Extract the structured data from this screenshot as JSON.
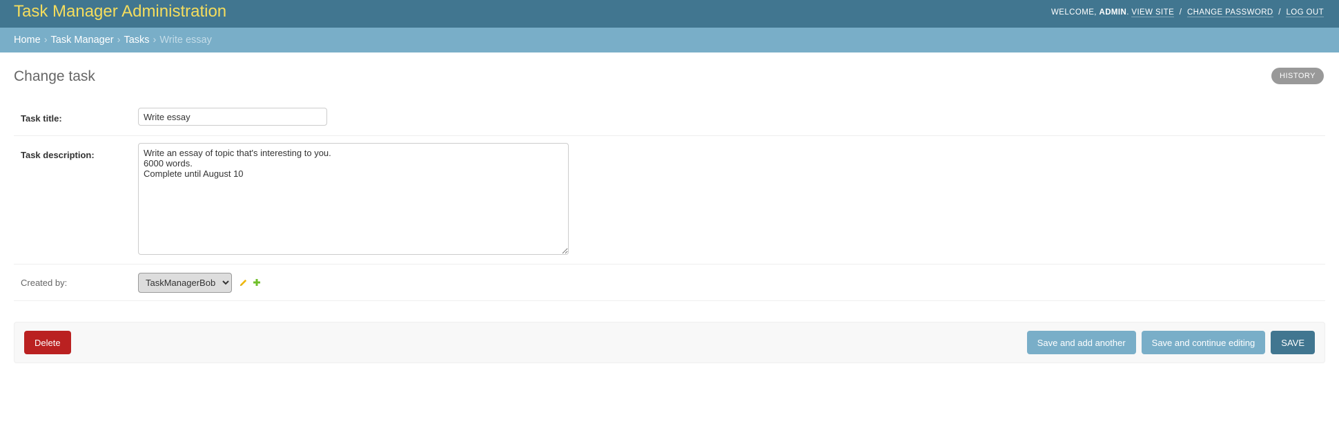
{
  "header": {
    "site_title": "Task Manager Administration",
    "welcome": "WELCOME,",
    "username": "ADMIN",
    "view_site": "VIEW SITE",
    "change_password": "CHANGE PASSWORD",
    "log_out": "LOG OUT",
    "separator": "/"
  },
  "breadcrumbs": {
    "items": [
      "Home",
      "Task Manager",
      "Tasks"
    ],
    "current": "Write essay",
    "separator": "›"
  },
  "page": {
    "title": "Change task",
    "history_label": "HISTORY"
  },
  "form": {
    "title_label": "Task title:",
    "title_value": "Write essay",
    "description_label": "Task description:",
    "description_value": "Write an essay of topic that's interesting to you.\n6000 words.\nComplete until August 10",
    "created_by_label": "Created by:",
    "created_by_value": "TaskManagerBob"
  },
  "icons": {
    "edit": "pencil-icon",
    "add": "plus-icon",
    "edit_color": "#efb80b",
    "add_color": "#70bf2b"
  },
  "actions": {
    "delete_label": "Delete",
    "save_add_another_label": "Save and add another",
    "save_continue_label": "Save and continue editing",
    "save_label": "SAVE"
  },
  "colors": {
    "header_bg": "#417690",
    "breadcrumb_bg": "#79aec8",
    "brand": "#f5dd5d",
    "delete": "#ba2121",
    "save": "#417690",
    "secondary": "#79aec8"
  }
}
